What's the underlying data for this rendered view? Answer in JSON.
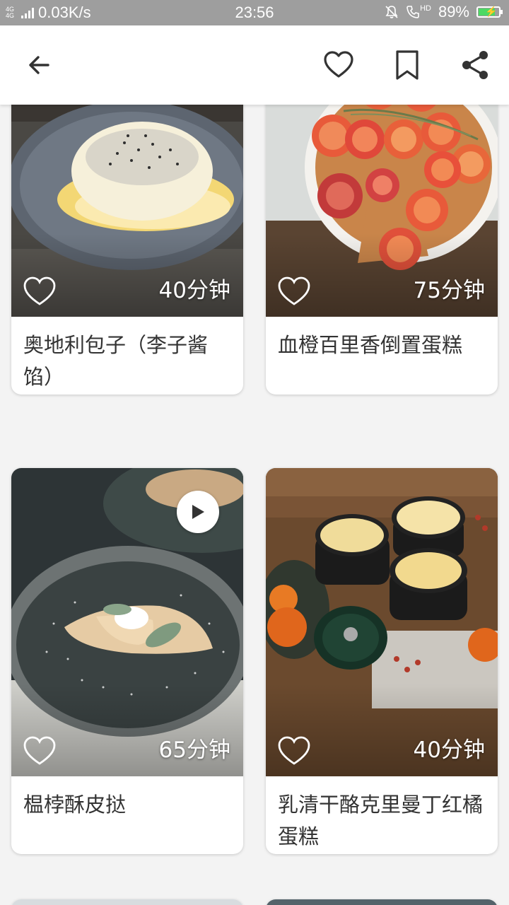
{
  "status_bar": {
    "network": "4G 4G",
    "speed": "0.03K/s",
    "time": "23:56",
    "hd": "HD",
    "battery": "89%",
    "battery_level": 0.89
  },
  "toolbar": {
    "icons": [
      "back-arrow-icon",
      "heart-icon",
      "bookmark-icon",
      "share-icon"
    ]
  },
  "recipes": [
    {
      "title": "奥地利包子（李子酱馅）",
      "duration": "40分钟",
      "has_video": false
    },
    {
      "title": "血橙百里香倒置蛋糕",
      "duration": "75分钟",
      "has_video": false
    },
    {
      "title": "榅桲酥皮挞",
      "duration": "65分钟",
      "has_video": true
    },
    {
      "title": "乳清干酪克里曼丁红橘蛋糕",
      "duration": "40分钟",
      "has_video": false
    }
  ],
  "colors": {
    "status_bar": "#9e9e9e",
    "toolbar": "#ffffff",
    "background": "#f3f3f3",
    "battery_fill": "#4cd964"
  }
}
